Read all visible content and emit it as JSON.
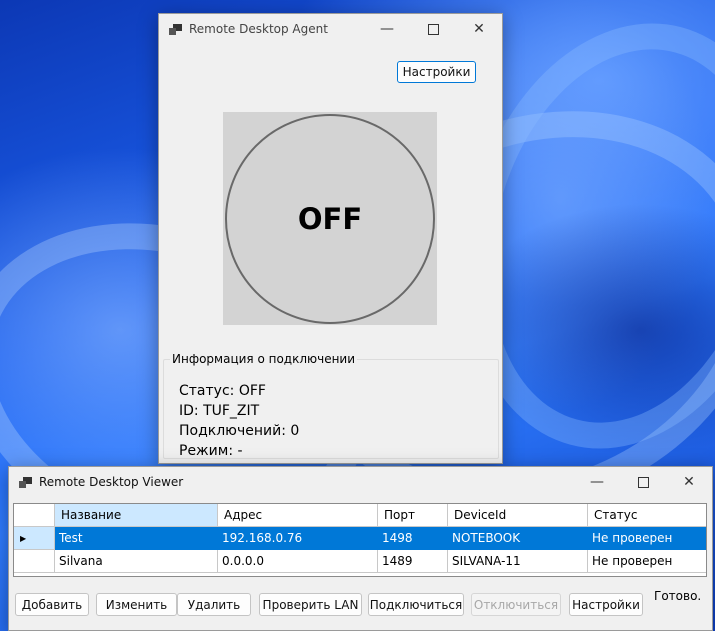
{
  "agent": {
    "title": "Remote Desktop Agent",
    "settings_label": "Настройки",
    "power_label": "OFF",
    "info_group_label": "Информация о подключении",
    "status_line": "Статус: OFF",
    "id_line": "ID: TUF_ZIT",
    "connections_line": "Подключений: 0",
    "mode_line": "Режим: -"
  },
  "viewer": {
    "title": "Remote Desktop Viewer",
    "columns": [
      "Название",
      "Адрес",
      "Порт",
      "DeviceId",
      "Статус"
    ],
    "rows": [
      {
        "name": "Test",
        "address": "192.168.0.76",
        "port": "1498",
        "device": "NOTEBOOK",
        "status": "Не проверен"
      },
      {
        "name": "Silvana",
        "address": "0.0.0.0",
        "port": "1489",
        "device": "SILVANA-11",
        "status": "Не проверен"
      }
    ],
    "buttons": {
      "add": "Добавить",
      "edit": "Изменить",
      "delete": "Удалить",
      "check_lan": "Проверить LAN",
      "connect": "Подключиться",
      "disconnect": "Отключиться",
      "settings": "Настройки"
    },
    "status_text": "Готово."
  },
  "colors": {
    "selection": "#0078d7",
    "header_selected": "#cce8ff",
    "power_circle_fill": "#d3d3d3"
  },
  "icons": [
    "app-icon",
    "minimize-icon",
    "maximize-icon",
    "close-icon",
    "row-pointer-icon"
  ]
}
